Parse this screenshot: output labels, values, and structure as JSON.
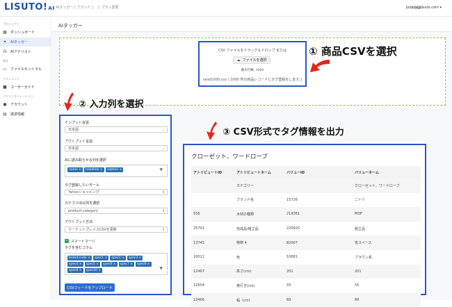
{
  "header": {
    "logo_text": "LISUTO!",
    "logo_sub": "AI",
    "breadcrumbs": [
      "[ AIタッガー | ブランド ]",
      "プラン変更"
    ],
    "language": "English",
    "user_email": "junichi@lisuto.com ▾"
  },
  "sidebar": {
    "section_project": "プロジェクト",
    "section_stats": "統計",
    "section_docs": "ドキュメント",
    "section_admin": "アドミニストレーション",
    "items": [
      {
        "label": "ダッシュボード",
        "icon": "grid-icon",
        "glyph": "▦"
      },
      {
        "label": "AIタッガー",
        "icon": "tagger-icon",
        "glyph": "✦"
      },
      {
        "label": "AIアナリスト",
        "icon": "network-icon",
        "glyph": "⁂"
      },
      {
        "label": "ファイルセントラル",
        "icon": "folder-icon",
        "glyph": "▭"
      },
      {
        "label": "ユーザーガイド",
        "icon": "guide-icon",
        "glyph": "■"
      },
      {
        "label": "アカウント",
        "icon": "user-icon",
        "glyph": "●"
      },
      {
        "label": "請求情報",
        "icon": "billing-icon",
        "glyph": "▤"
      }
    ]
  },
  "page": {
    "title": "AIタッガー"
  },
  "upload": {
    "drop_text": "CSV ファイルをドラッグ＆ドロップ または",
    "file_button": "ファイルを選択",
    "max_rows": "最大行数: 1000",
    "status": "rand1000.csv ( 1000 件の商品レコードにタグ登録をします。)"
  },
  "callouts": {
    "step1": "① 商品CSVを選択",
    "step2": "② 入力列を選択",
    "step3": "③ CSV形式でタグ情報を出力"
  },
  "form": {
    "input_lang_label": "インプット言語",
    "input_lang_value": "日本語",
    "output_lang_label": "アウトプット言語",
    "output_lang_value": "日本語",
    "ai_columns_label": "AIに読み取らせる列を選択",
    "ai_columns_tags": [
      "name ×",
      "headline ×",
      "caption ×"
    ],
    "mall_label": "タグ登録したいモール",
    "mall_value": "Yahooショッピング",
    "category_col_label": "カテゴリIDの列を選択",
    "category_col_value": "product-category",
    "output_method_label": "アウトプット方法",
    "output_method_value": "マーケットプレイスCSVを更新",
    "smart_merge_label": "スマートマージ",
    "tag_columns_label": "タグを含むコラム",
    "tag_columns_tags": [
      "brand-code ×",
      "spec1 ×",
      "spec2 ×",
      "spec3 ×",
      "spec4 ×",
      "spec5 ×",
      "spec6 ×",
      "spec7 ×",
      "spec8 ×",
      "spec9 ×",
      "spec10 ×"
    ],
    "upload_button": "CSVフィードをアップロード"
  },
  "result": {
    "title": "クローゼット、ワードローブ",
    "headers": [
      "アトリビュートID",
      "アトリビュートネーム",
      "バリューID",
      "バリューネーム"
    ],
    "rows": [
      [
        "",
        "カテゴリー",
        "",
        "クローゼット、ワードローブ"
      ],
      [
        "",
        "ブランド名",
        "15726",
        "ニトリ"
      ],
      [
        "556",
        "木材の種類",
        "219361",
        "MDF"
      ],
      [
        "25701",
        "完成品/組立品",
        "220925",
        "組立品"
      ],
      [
        "13745",
        "特徴 4",
        "82007",
        "省スペース"
      ],
      [
        "10011",
        "色",
        "10681",
        "ブラウン系"
      ],
      [
        "12467",
        "高さ(cm)",
        "201",
        "201"
      ],
      [
        "12504",
        "奥行き(cm)",
        "55",
        "55"
      ],
      [
        "12466",
        "幅（cm）",
        "89",
        "89"
      ]
    ]
  },
  "colors": {
    "accent": "#2a53c9",
    "arrow": "#e5241c",
    "drop_border": "#8bc34a"
  }
}
